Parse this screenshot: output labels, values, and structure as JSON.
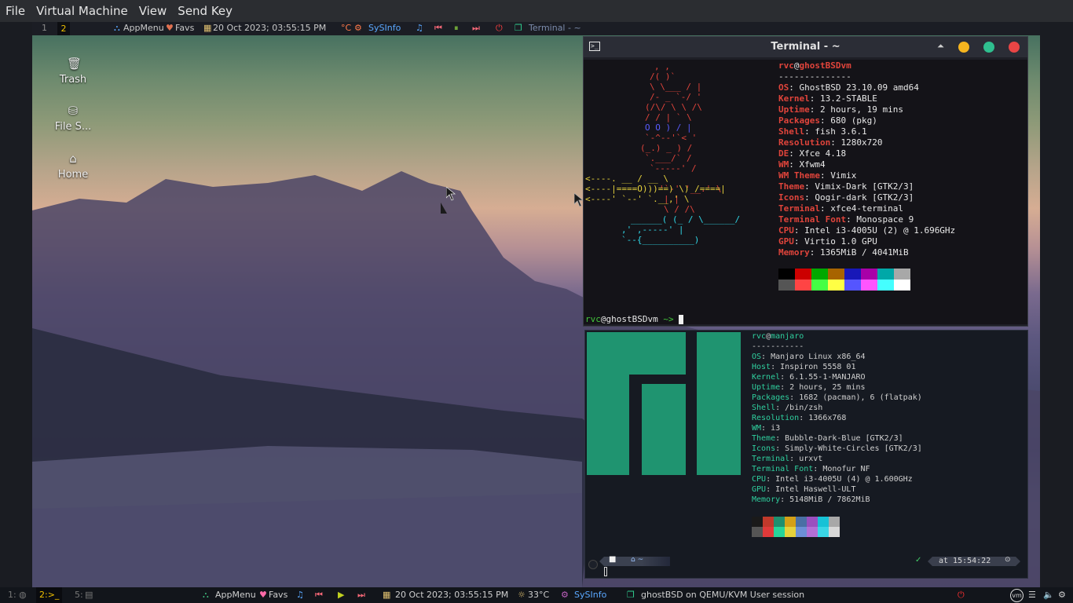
{
  "host_menu": [
    "File",
    "Virtual Machine",
    "View",
    "Send Key"
  ],
  "vm_top_panel": {
    "workspaces": [
      "1",
      "2"
    ],
    "appmenu": "AppMenu",
    "favs": "Favs",
    "datetime": "20 Oct 2023; 03:55:15 PM",
    "temp_unit": "°C",
    "sysinfo": "SySInfo",
    "terminal_task": "Terminal - ~"
  },
  "desktop_icons": [
    {
      "label": "Trash"
    },
    {
      "label": "File S..."
    },
    {
      "label": "Home"
    }
  ],
  "terminal_window": {
    "title": "Terminal - ~",
    "user": "rvc",
    "host": "ghostBSDvm",
    "separator": "--------------",
    "info": [
      {
        "label": "OS",
        "value": "GhostBSD 23.10.09 amd64"
      },
      {
        "label": "Kernel",
        "value": "13.2-STABLE"
      },
      {
        "label": "Uptime",
        "value": "2 hours, 19 mins"
      },
      {
        "label": "Packages",
        "value": "680 (pkg)"
      },
      {
        "label": "Shell",
        "value": "fish 3.6.1"
      },
      {
        "label": "Resolution",
        "value": "1280x720"
      },
      {
        "label": "DE",
        "value": "Xfce 4.18"
      },
      {
        "label": "WM",
        "value": "Xfwm4"
      },
      {
        "label": "WM Theme",
        "value": "Vimix"
      },
      {
        "label": "Theme",
        "value": "Vimix-Dark [GTK2/3]"
      },
      {
        "label": "Icons",
        "value": "Qogir-dark [GTK2/3]"
      },
      {
        "label": "Terminal",
        "value": "xfce4-terminal"
      },
      {
        "label": "Terminal Font",
        "value": "Monospace 9"
      },
      {
        "label": "CPU",
        "value": "Intel i3-4005U (2) @ 1.696GHz"
      },
      {
        "label": "GPU",
        "value": "Virtio 1.0 GPU"
      },
      {
        "label": "Memory",
        "value": "1365MiB / 4041MiB"
      }
    ],
    "prompt_user": "rvc",
    "prompt_host": "@ghostBSDvm",
    "prompt_suffix": " ~> ",
    "palette_top": [
      "#000000",
      "#cc0000",
      "#00a800",
      "#a86400",
      "#1818b8",
      "#a800a8",
      "#00a8a8",
      "#a8a8a8"
    ],
    "palette_bottom": [
      "#555555",
      "#ff4444",
      "#44ff44",
      "#ffff44",
      "#5555ff",
      "#ff55ff",
      "#44ffff",
      "#ffffff"
    ]
  },
  "manjaro_window": {
    "user": "rvc",
    "host": "manjaro",
    "separator": "-----------",
    "info": [
      {
        "label": "OS",
        "value": "Manjaro Linux x86_64"
      },
      {
        "label": "Host",
        "value": "Inspiron 5558 01"
      },
      {
        "label": "Kernel",
        "value": "6.1.55-1-MANJARO"
      },
      {
        "label": "Uptime",
        "value": "2 hours, 25 mins"
      },
      {
        "label": "Packages",
        "value": "1682 (pacman), 6 (flatpak)"
      },
      {
        "label": "Shell",
        "value": "/bin/zsh"
      },
      {
        "label": "Resolution",
        "value": "1366x768"
      },
      {
        "label": "WM",
        "value": "i3"
      },
      {
        "label": "Theme",
        "value": "Bubble-Dark-Blue [GTK2/3]"
      },
      {
        "label": "Icons",
        "value": "Simply-White-Circles [GTK2/3]"
      },
      {
        "label": "Terminal",
        "value": "urxvt"
      },
      {
        "label": "Terminal Font",
        "value": "Monofur NF"
      },
      {
        "label": "CPU",
        "value": "Intel i3-4005U (4) @ 1.600GHz"
      },
      {
        "label": "GPU",
        "value": "Intel Haswell-ULT"
      },
      {
        "label": "Memory",
        "value": "5148MiB / 7862MiB"
      }
    ],
    "prompt_right": "at 15:54:22",
    "palette_top": [
      "#1a1a1a",
      "#c0392b",
      "#1f8f6f",
      "#d4a017",
      "#4a6fa5",
      "#9b4fbf",
      "#17c2d6",
      "#a8a8a8"
    ],
    "palette_bottom": [
      "#555555",
      "#e03a3a",
      "#27d49a",
      "#e6d23c",
      "#6c8fd6",
      "#b36fd6",
      "#3ad6e6",
      "#d8d8d8"
    ]
  },
  "bottom_panel": {
    "ws1": "1:",
    "ws2": "2:>_",
    "ws5": "5:",
    "appmenu": "AppMenu",
    "favs": "Favs",
    "datetime": "20 Oct 2023; 03:55:15 PM",
    "temperature": "33°C",
    "sysinfo": "SySInfo",
    "session": "ghostBSD on QEMU/KVM User session"
  }
}
